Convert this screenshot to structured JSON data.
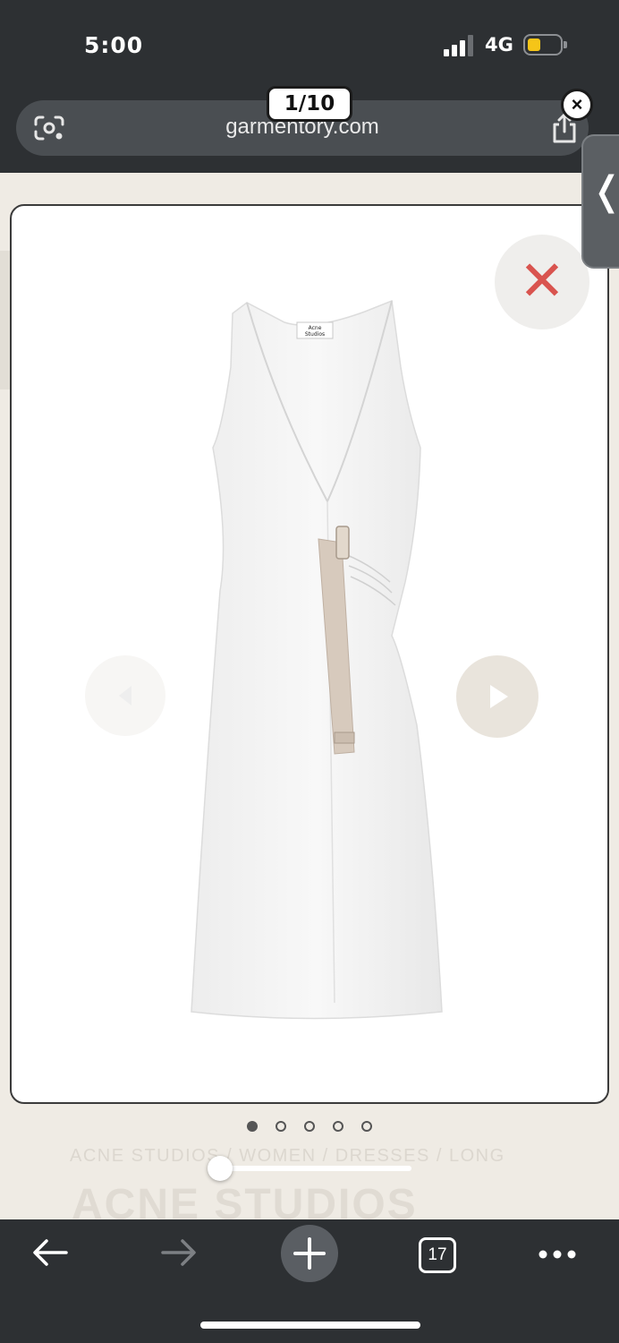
{
  "status_bar": {
    "time": "5:00",
    "network": "4G"
  },
  "browser": {
    "url": "garmentory.com",
    "tab_count": "17",
    "icons": [
      "google-lens-icon",
      "share-icon",
      "back-arrow-icon",
      "forward-arrow-icon",
      "new-tab-plus-icon",
      "tabs-icon",
      "more-dots-icon"
    ]
  },
  "gallery": {
    "counter": "1/10",
    "current_index": 1,
    "total": 10,
    "dots": [
      true,
      false,
      false,
      false,
      false
    ],
    "product_image": "white sleeveless wrap midi dress with beige buckle strap",
    "label_text": "Acne Studios"
  },
  "page": {
    "breadcrumb": "ACNE STUDIOS / WOMEN / DRESSES / LONG",
    "brand": "ACNE STUDIOS"
  },
  "colors": {
    "chrome": "#2d3033",
    "close_x": "#d9544f",
    "page_bg": "#efebe4"
  }
}
